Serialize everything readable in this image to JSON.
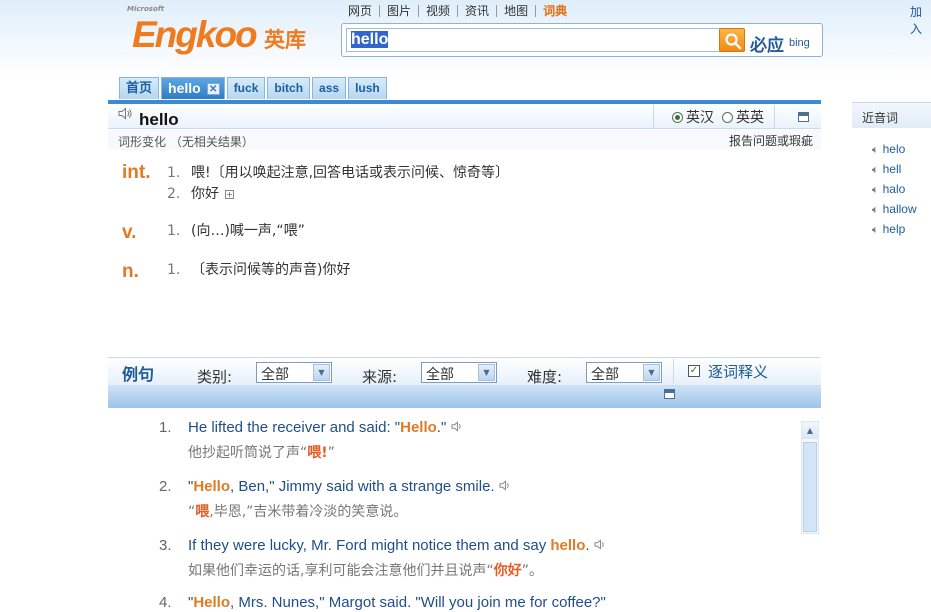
{
  "header": {
    "ms_label": "Microsoft",
    "logo": "Engkoo",
    "logo_cn": "英库",
    "nav": [
      "网页",
      "图片",
      "视频",
      "资讯",
      "地图",
      "词典"
    ],
    "nav_active_index": 5,
    "top_right_link": "加入",
    "search": {
      "value": "hello"
    },
    "bing_cn": "必应",
    "bing_en": "bing"
  },
  "tabs": {
    "home": "首页",
    "current": "hello",
    "close_glyph": "✕",
    "history": [
      "fuck",
      "bitch",
      "ass",
      "lush"
    ]
  },
  "word": {
    "headword": "hello",
    "modes": [
      "英汉",
      "英英"
    ],
    "selected_mode": "英汉",
    "inflection": "词形变化 （无相关结果）",
    "report": "报告问题或瑕疵"
  },
  "definitions": [
    {
      "pos": "int.",
      "senses": [
        {
          "n": "1.",
          "text": "喂!〔用以唤起注意,回答电话或表示问候、惊奇等〕"
        },
        {
          "n": "2.",
          "text": "你好"
        }
      ]
    },
    {
      "pos": "v.",
      "senses": [
        {
          "n": "1.",
          "text": "(向…)喊一声,“喂”"
        }
      ]
    },
    {
      "pos": "n.",
      "senses": [
        {
          "n": "1.",
          "text": "〔表示问候等的声音)你好"
        }
      ]
    }
  ],
  "examples_bar": {
    "title": "例句",
    "filters": [
      {
        "label": "类别:",
        "value": "全部"
      },
      {
        "label": "来源:",
        "value": "全部"
      },
      {
        "label": "难度:",
        "value": "全部"
      }
    ],
    "word_by_word": "逐词释义"
  },
  "sentences": [
    {
      "n": "1.",
      "en_parts": [
        "He lifted the receiver and said: \"",
        "Hello",
        ".\""
      ],
      "cn_parts": [
        "他抄起听筒说了声“",
        "喂!",
        "”"
      ]
    },
    {
      "n": "2.",
      "en_parts": [
        "\"",
        "Hello",
        ", Ben,\" Jimmy said with a strange smile."
      ],
      "cn_parts": [
        "“",
        "喂",
        ",毕恩,”吉米带着冷淡的笑意说。"
      ]
    },
    {
      "n": "3.",
      "en_parts": [
        "If they were lucky, Mr. Ford might notice them and say ",
        "hello",
        "."
      ],
      "cn_parts": [
        "如果他们幸运的话,享利可能会注意他们并且说声“",
        "你好",
        "”。"
      ]
    },
    {
      "n": "4.",
      "en_parts": [
        "\"",
        "Hello",
        ", Mrs. Nunes,\" Margot said. \"Will you join me for coffee?\""
      ],
      "cn_parts": [
        "",
        "",
        ""
      ]
    }
  ],
  "right_panel": {
    "title": "近音词",
    "items": [
      "helo",
      "hell",
      "halo",
      "hallow",
      "help"
    ]
  }
}
